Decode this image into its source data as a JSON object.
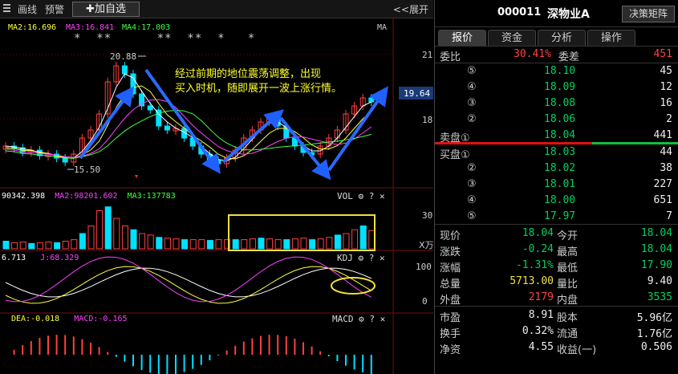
{
  "toolbar": {
    "draw_line": "画线",
    "alert": "预警",
    "add_watchlist": "✚加自选",
    "expand": "<<展开"
  },
  "main_chart": {
    "ma_legend": [
      {
        "label": "MA2:16.696",
        "color": "#ffff40"
      },
      {
        "label": "MA3:16.841",
        "color": "#ff40ff"
      },
      {
        "label": "MA4:17.003",
        "color": "#40ff40"
      }
    ],
    "ma_tag": "MA",
    "stars": "*  **      **  **  *   *",
    "high_label": "20.88",
    "low_label": "15.50",
    "price_axis": [
      "21",
      "18"
    ],
    "current_price_tag": "19.64",
    "annotation": "经过前期的地位震荡调整，出现\n买入时机，随即展开一波上涨行情。"
  },
  "volume_panel": {
    "legend": [
      {
        "label": "90342.398",
        "color": "#ffffff"
      },
      {
        "label": "MA2:98201.602",
        "color": "#ff40ff"
      },
      {
        "label": "MA3:137783",
        "color": "#40ff40"
      }
    ],
    "name": "VOL",
    "axis": [
      "30"
    ],
    "unit": "X万"
  },
  "kdj_panel": {
    "legend": [
      {
        "label": "6.713",
        "color": "#ffffff"
      },
      {
        "label": "J:68.329",
        "color": "#ff40ff"
      }
    ],
    "name": "KDJ",
    "axis": [
      "100",
      "50",
      "0"
    ]
  },
  "macd_panel": {
    "legend": [
      {
        "label": "DEA:-0.018",
        "color": "#ffff40"
      },
      {
        "label": "MACD:-0.165",
        "color": "#ff40ff"
      }
    ],
    "name": "MACD"
  },
  "quote": {
    "code": "000011",
    "name": "深物业A",
    "decision_button": "决策矩阵",
    "tabs": [
      "报价",
      "资金",
      "分析",
      "操作"
    ],
    "weibi_label": "委比",
    "weibi_value": "30.41%",
    "weicha_label": "委差",
    "weicha_value": "451",
    "sell_label": "卖盘①",
    "buy_label": "买盘①",
    "asks": [
      {
        "level": "⑤",
        "price": "18.10",
        "vol": "45"
      },
      {
        "level": "④",
        "price": "18.09",
        "vol": "12"
      },
      {
        "level": "③",
        "price": "18.08",
        "vol": "16"
      },
      {
        "level": "②",
        "price": "18.06",
        "vol": "2"
      },
      {
        "level": "",
        "price": "18.04",
        "vol": "441"
      }
    ],
    "bids": [
      {
        "level": "",
        "price": "18.03",
        "vol": "44"
      },
      {
        "level": "②",
        "price": "18.02",
        "vol": "38"
      },
      {
        "level": "③",
        "price": "18.01",
        "vol": "227"
      },
      {
        "level": "④",
        "price": "18.00",
        "vol": "651"
      },
      {
        "level": "⑤",
        "price": "17.97",
        "vol": "7"
      }
    ],
    "stats": [
      {
        "l1": "现价",
        "v1": "18.04",
        "c1": "green",
        "l2": "今开",
        "v2": "18.04",
        "c2": "green"
      },
      {
        "l1": "涨跌",
        "v1": "-0.24",
        "c1": "green",
        "l2": "最高",
        "v2": "18.04",
        "c2": "green"
      },
      {
        "l1": "涨幅",
        "v1": "-1.31%",
        "c1": "green",
        "l2": "最低",
        "v2": "17.90",
        "c2": "green"
      },
      {
        "l1": "总量",
        "v1": "5713.00",
        "c1": "yellow",
        "l2": "量比",
        "v2": "9.40",
        "c2": "white"
      },
      {
        "l1": "外盘",
        "v1": "2179",
        "c1": "red",
        "l2": "内盘",
        "v2": "3535",
        "c2": "green"
      }
    ],
    "fundamentals": [
      {
        "l1": "市盈",
        "v1": "8.91",
        "l2": "股本",
        "v2": "5.96亿"
      },
      {
        "l1": "换手",
        "v1": "0.32%",
        "l2": "流通",
        "v2": "1.76亿"
      },
      {
        "l1": "净资",
        "v1": "4.55",
        "l2": "收益(一)",
        "v2": "0.506"
      }
    ]
  },
  "colors": {
    "up": "#ff4040",
    "down": "#00e0ff",
    "accent_red": "#ff4040",
    "accent_green": "#00d060"
  }
}
